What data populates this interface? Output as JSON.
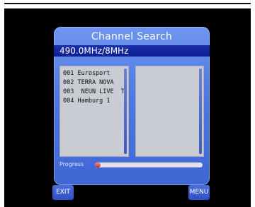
{
  "dialog": {
    "title": "Channel Search",
    "frequency": "490.0MHz/8MHz"
  },
  "channels": [
    "001 Eurosport",
    "002 TERRA NOVA",
    "003  NEUN LIVE  T",
    "004 Hamburg 1"
  ],
  "right_list": [],
  "progress": {
    "label": "Progress",
    "fraction": 0.05
  },
  "footer": {
    "exit_label": "EXIT",
    "menu_label": "MENU"
  },
  "colors": {
    "dialog_blue": "#4f77e0",
    "frequency_bar": "#0d1f8f",
    "list_background": "#c9ccd2",
    "progress_fill": "#d02a2a",
    "button_blue": "#2f4fc4"
  }
}
